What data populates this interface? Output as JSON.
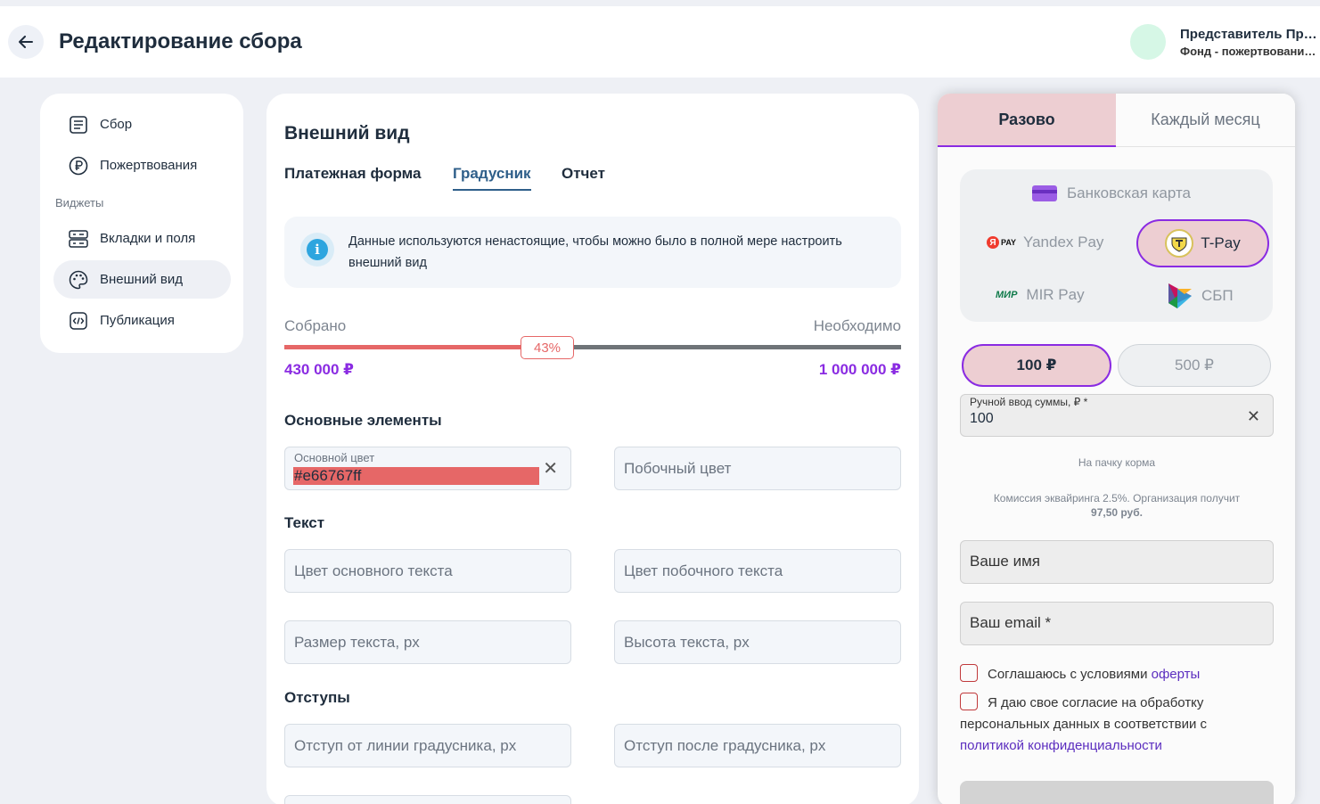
{
  "header": {
    "title": "Редактирование сбора",
    "user_name": "Представитель Пре...",
    "user_org": "Фонд - пожертвования,..."
  },
  "sidebar": {
    "items": [
      {
        "label": "Сбор",
        "icon": "list-icon"
      },
      {
        "label": "Пожертвования",
        "icon": "ruble-icon"
      },
      {
        "label": "Вкладки и поля",
        "icon": "server-icon"
      },
      {
        "label": "Внешний вид",
        "icon": "palette-icon"
      },
      {
        "label": "Публикация",
        "icon": "code-icon"
      }
    ],
    "group_label": "Виджеты",
    "active_item": "Внешний вид"
  },
  "main": {
    "section_title": "Внешний вид",
    "tabs": [
      {
        "label": "Платежная форма"
      },
      {
        "label": "Градусник"
      },
      {
        "label": "Отчет"
      }
    ],
    "active_tab": "Градусник",
    "info_text": "Данные используются ненастоящие, чтобы можно было в полной мере настроить внешний вид",
    "progress": {
      "collected_label": "Собрано",
      "needed_label": "Необходимо",
      "percent_text": "43%",
      "percent_value": 43,
      "collected_amount": "430 000 ₽",
      "needed_amount": "1 000 000 ₽"
    },
    "groups": {
      "basic": "Основные элементы",
      "text": "Текст",
      "padding": "Отступы"
    },
    "fields": {
      "primary_color_label": "Основной цвет",
      "primary_color_value": "#e66767ff",
      "secondary_color": "Побочный цвет",
      "main_text_color": "Цвет основного текста",
      "secondary_text_color": "Цвет побочного текста",
      "text_size": "Размер текста, px",
      "text_height": "Высота текста, px",
      "offset_from_line": "Отступ от линии градусника, px",
      "offset_after": "Отступ после градусника, px"
    },
    "clear_glyph": "✕"
  },
  "widget": {
    "tab_once": "Разово",
    "tab_monthly": "Каждый месяц",
    "payment": {
      "bank_card": "Банковская карта",
      "yandex_pay": "Yandex Pay",
      "tpay": "T-Pay",
      "mir_pay": "MIR Pay",
      "sbp": "СБП",
      "yandex_logo_text": "PAY",
      "mir_logo_text": "МИР"
    },
    "amounts": [
      "100 ₽",
      "500 ₽"
    ],
    "manual_amount_label": "Ручной ввод суммы, ₽ *",
    "manual_amount_value": "100",
    "amount_hint": "На пачку корма",
    "commission_text": "Комиссия эквайринга 2.5%. Организация получит",
    "commission_value": "97,50 руб.",
    "name_placeholder": "Ваше имя",
    "email_placeholder": "Ваш email *",
    "agree_offer_prefix": "Соглашаюсь с условиями ",
    "agree_offer_link": "оферты",
    "agree_personal_text": "Я даю свое согласие на обработку персональных данных в соответствии с ",
    "agree_personal_link": "политикой конфиденциальности"
  },
  "colors": {
    "accent": "#8a2be2",
    "progress_fill": "#e66767",
    "progress_rest": "#6f7478",
    "selected_bg": "#edced2"
  }
}
